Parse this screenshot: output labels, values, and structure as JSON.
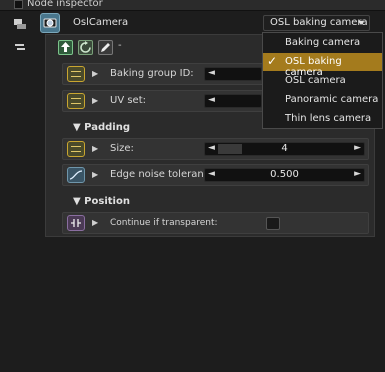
{
  "window": {
    "title": "Node inspector"
  },
  "node": {
    "name": "OslCamera",
    "camera_type": "OSL baking camera"
  },
  "toolbar": {
    "dash": "-"
  },
  "params": [
    {
      "label": "Baking group ID:",
      "left_arrow": "◄",
      "right_arrow": "►",
      "icon": "slider-icon"
    },
    {
      "label": "UV set:",
      "left_arrow": "◄",
      "right_arrow": "►",
      "icon": "slider-icon"
    }
  ],
  "padding": {
    "title": "Padding",
    "size": {
      "label": "Size:",
      "value": "4",
      "left_arrow": "◄",
      "right_arrow": "►"
    },
    "edge": {
      "label": "Edge noise tolerance:",
      "value": "0.500",
      "left_arrow": "◄",
      "right_arrow": "►"
    }
  },
  "position": {
    "title": "Position",
    "continue": {
      "label": "Continue if transparent:",
      "checked": false
    }
  },
  "menu": {
    "options": [
      "Baking camera",
      "OSL baking camera",
      "OSL camera",
      "Panoramic camera",
      "Thin lens camera"
    ],
    "selected": "OSL baking camera",
    "checkmark": "✓"
  },
  "colors": {
    "accent": "#a47b1d",
    "panel": "#2b2b2b",
    "background": "#1d1d1d"
  }
}
